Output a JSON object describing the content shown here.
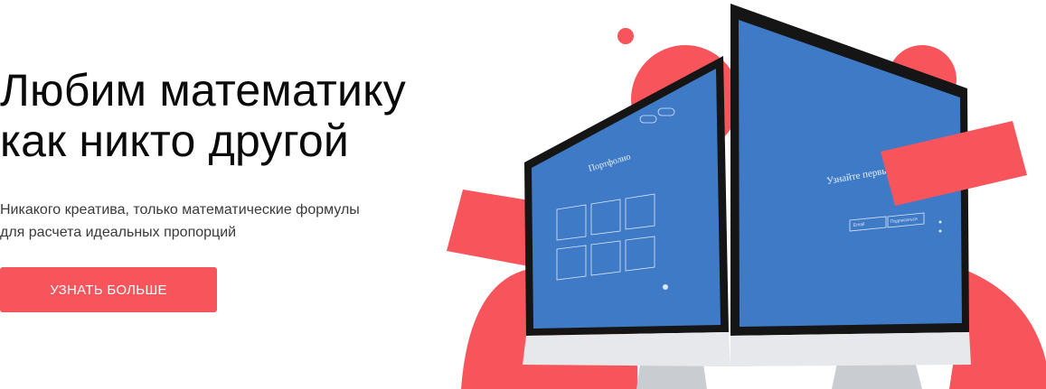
{
  "hero": {
    "title_line1": "Любим математику",
    "title_line2": "как никто другой",
    "subtitle_line1": "Никакого креатива, только математические формулы",
    "subtitle_line2": "для расчета идеальных пропорций",
    "cta_label": "УЗНАТЬ БОЛЬШЕ"
  },
  "screens": {
    "left_heading": "Портфолио",
    "right_heading": "Узнайте первым о новостях",
    "right_input_placeholder": "Email",
    "right_button": "Подписаться"
  },
  "colors": {
    "accent": "#f7545b",
    "screen_blue": "#3f7ac6",
    "text_dark": "#0a0a0a",
    "text_muted": "#3a3a3a"
  }
}
